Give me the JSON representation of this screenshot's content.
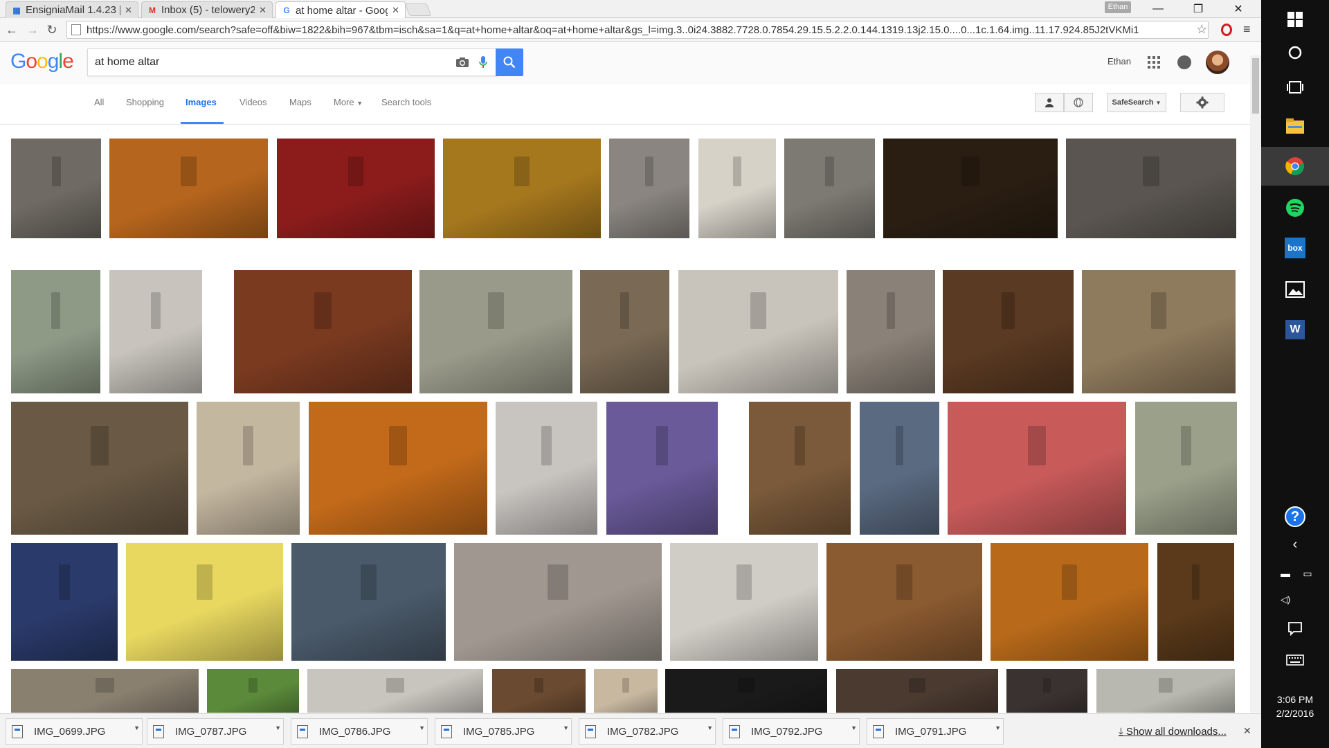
{
  "browser": {
    "tabs": [
      {
        "title": "EnsigniaMail 1.4.23 [",
        "icon": "grid-icon"
      },
      {
        "title": "Inbox (5) - telowery2",
        "icon": "gmail-icon"
      },
      {
        "title": "at home altar - Goog",
        "icon": "google-icon",
        "active": true
      }
    ],
    "profile_label": "Ethan",
    "url": "https://www.google.com/search?safe=off&biw=1822&bih=967&tbm=isch&sa=1&q=at+home+altar&oq=at+home+altar&gs_l=img.3..0i24.3882.7728.0.7854.29.15.5.2.2.0.144.1319.13j2.15.0....0...1c.1.64.img..11.17.924.85J2tVKMi1"
  },
  "google": {
    "logo": "Google",
    "query": "at home altar",
    "user_name": "Ethan",
    "nav_tabs": [
      "All",
      "Shopping",
      "Images",
      "Videos",
      "Maps",
      "More",
      "Search tools"
    ],
    "active_tab": "Images",
    "safesearch_label": "SafeSearch"
  },
  "downloads": {
    "files": [
      "IMG_0699.JPG",
      "IMG_0787.JPG",
      "IMG_0786.JPG",
      "IMG_0785.JPG",
      "IMG_0782.JPG",
      "IMG_0792.JPG",
      "IMG_0791.JPG"
    ],
    "show_all": "Show all downloads..."
  },
  "taskbar": {
    "time": "3:06 PM",
    "date": "2/2/2016",
    "pinned": [
      "windows-start-icon",
      "cortana-icon",
      "task-view-icon",
      "file-explorer-icon",
      "chrome-icon",
      "spotify-icon",
      "box-icon",
      "photos-icon",
      "word-icon"
    ]
  },
  "results": {
    "count_shown": 48,
    "colors": [
      "#6f6a63",
      "#b5651d",
      "#8c1c1c",
      "#a6781e",
      "#8a8580",
      "#d7d2c8",
      "#7d7a73",
      "#2a1e12",
      "#5a5550",
      "#8e9a86",
      "#c8c4bd",
      "#7a3a20",
      "#9a9a8a",
      "#7a6a55",
      "#c9c4bb",
      "#8a8278",
      "#5a3a22",
      "#8e7a5c",
      "#6a5a45",
      "#c4b7a0",
      "#c36a1a",
      "#c8c4c0",
      "#6a5a9a",
      "#7a5a3a",
      "#5a6a80",
      "#c85a5a",
      "#9aa08a",
      "#2a3a6a",
      "#e8d860",
      "#4a5a6a",
      "#a09890",
      "#d0ccc6",
      "#8a5a30",
      "#b86a1a",
      "#5a3a1a",
      "#8a8070",
      "#5a8a3a",
      "#c8c4be",
      "#6a4a30",
      "#c8b8a0",
      "#1a1a1a",
      "#4a3a30",
      "#3a3230",
      "#b8b8b0",
      "#c8a030"
    ]
  }
}
